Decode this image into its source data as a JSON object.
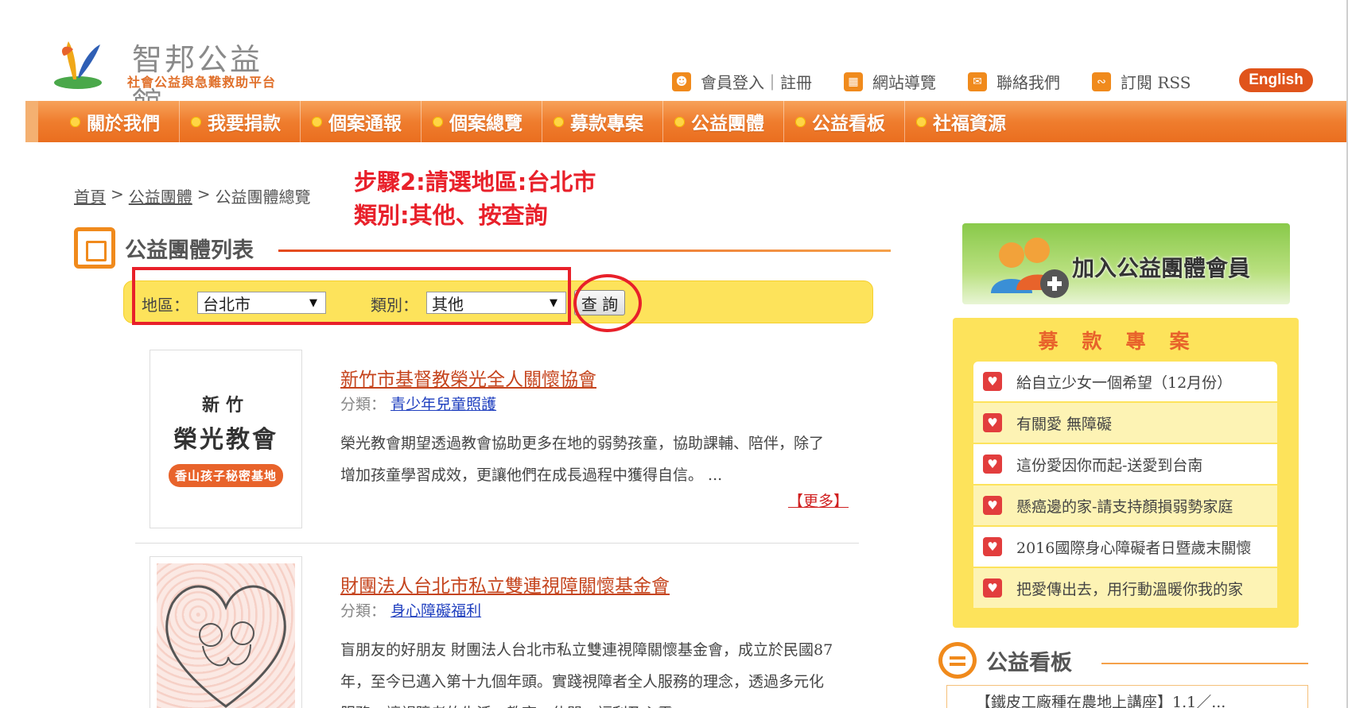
{
  "header": {
    "site_title": "智邦公益館",
    "site_subtitle": "社會公益與急難救助平台",
    "links": [
      {
        "label": "會員登入｜註冊",
        "icon": "member-icon"
      },
      {
        "label": "網站導覽",
        "icon": "sitemap-icon"
      },
      {
        "label": "聯絡我們",
        "icon": "contact-icon"
      },
      {
        "label": "訂閱 RSS",
        "icon": "rss-icon"
      }
    ],
    "english_label": "English"
  },
  "nav": {
    "items": [
      {
        "label": "關於我們"
      },
      {
        "label": "我要捐款"
      },
      {
        "label": "個案通報"
      },
      {
        "label": "個案總覽"
      },
      {
        "label": "募款專案"
      },
      {
        "label": "公益團體"
      },
      {
        "label": "公益看板"
      },
      {
        "label": "社福資源"
      }
    ]
  },
  "breadcrumb": {
    "home": "首頁",
    "sep": ">",
    "level2": "公益團體",
    "current": "公益團體總覽"
  },
  "annotation": {
    "line1": "步驟2:請選地區:台北市",
    "line2": "類別:其他、按查詢"
  },
  "section": {
    "title": "公益團體列表"
  },
  "filter": {
    "region_label": "地區：",
    "region_value": "台北市",
    "category_label": "類別：",
    "category_value": "其他",
    "query_label": "查 詢"
  },
  "entries": [
    {
      "title": "新竹市基督教榮光全人關懷協會",
      "cat_label": "分類：",
      "category": "青少年兒童照護",
      "desc": "榮光教會期望透過教會協助更多在地的弱勢孩童，協助課輔、陪伴，除了增加孩童學習成效，更讓他們在成長過程中獲得自信。 ...",
      "more": "【更多】",
      "thumb_l1": "新竹",
      "thumb_l2": "榮光教會",
      "thumb_pill": "香山孩子秘密基地"
    },
    {
      "title": "財團法人台北市私立雙連視障關懷基金會",
      "cat_label": "分類：",
      "category": "身心障礙福利",
      "desc": "盲朋友的好朋友 財團法人台北市私立雙連視障關懷基金會，成立於民國87年，至今已邁入第十九個年頭。實踐視障者全人服務的理念，透過多元化服務，讓視障者的生活、教育、休閒、福利及心靈"
    }
  ],
  "sidebar": {
    "join_label": "加入公益團體會員",
    "fund_title": "募款專案",
    "fund_items": [
      "給自立少女一個希望（12月份）",
      "有關愛 無障礙",
      "這份愛因你而起-送愛到台南",
      "懸癌邊的家-請支持顏損弱勢家庭",
      "2016國際身心障礙者日暨歲末關懷",
      "把愛傳出去，用行動溫暖你我的家"
    ],
    "board_title": "公益看板",
    "board_item": "【鐵皮工廠種在農地上講座】1.1／..."
  },
  "colors": {
    "nav_orange": "#ef7d2e",
    "accent_yellow": "#fde35b",
    "annotation_red": "#e8202a",
    "link_blue": "#1f3fbf",
    "title_orange": "#c5441d"
  }
}
